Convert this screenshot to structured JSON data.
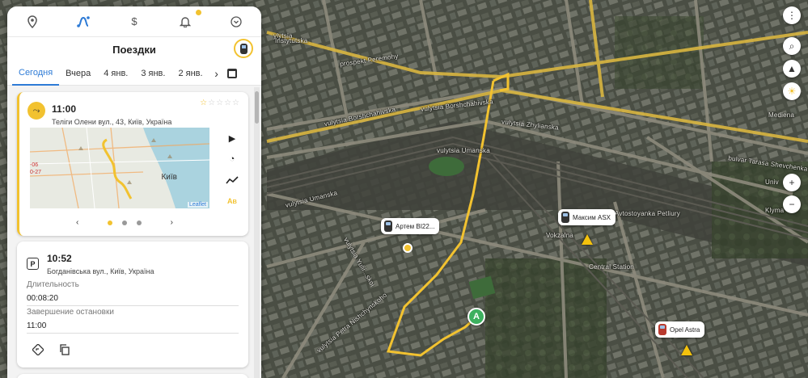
{
  "colors": {
    "accent": "#f2c230",
    "link": "#2e7bd6",
    "route": "#f2c230",
    "marker_a": "#3db05f"
  },
  "icon_bar": [
    {
      "name": "location-pin-icon"
    },
    {
      "name": "trips-icon",
      "active": true
    },
    {
      "name": "dollar-icon"
    },
    {
      "name": "bell-icon"
    },
    {
      "name": "chevron-down-icon"
    }
  ],
  "panel": {
    "title": "Поездки",
    "tabs": [
      "Сегодня",
      "Вчера",
      "4 янв.",
      "3 янв.",
      "2 янв."
    ],
    "next_arrow": "›"
  },
  "trip": {
    "time": "11:00",
    "address": "Теліги Олени вул., 43, Київ, Україна",
    "rating": 1,
    "map_city": "Київ",
    "map_attrib": "Leaflet",
    "map_side_label": "-06\n0-27",
    "pager_prev": "‹",
    "pager_next": "›",
    "pages": 3,
    "current_page": 1
  },
  "stop": {
    "time": "10:52",
    "address": "Богданівська вул., Київ, Україна",
    "duration_label": "Длительность",
    "duration_value": "00:08:20",
    "end_label": "Завершение остановки",
    "end_value": "11:00"
  },
  "map": {
    "street_labels": [
      "ylytsia",
      "Instytutska",
      "prospekt Peremohy",
      "vulytsia Borshchahivska",
      "vulytsia Borshchahivska",
      "vulytsia Zhylianska",
      "vulytsia Umanska",
      "vulytsia Umanska",
      "vulytsia Yulii...skoi",
      "vulytsia Petra Nishchynskoho",
      "Vokzalna",
      "Avtostoyanka Petliury",
      "Central Station",
      "bulvar Tarasa Shevchenka",
      "Univ",
      "Klyma",
      "Mediena"
    ],
    "vehicles": [
      {
        "label": "Артем ВІ22..."
      },
      {
        "label": "Максим ASX"
      },
      {
        "label": "Opel Astra"
      }
    ],
    "marker_a": "A",
    "controls": [
      "more-vertical-icon",
      "search-icon",
      "compass-icon",
      "sun-icon",
      "zoom-in-icon",
      "zoom-out-icon"
    ]
  }
}
